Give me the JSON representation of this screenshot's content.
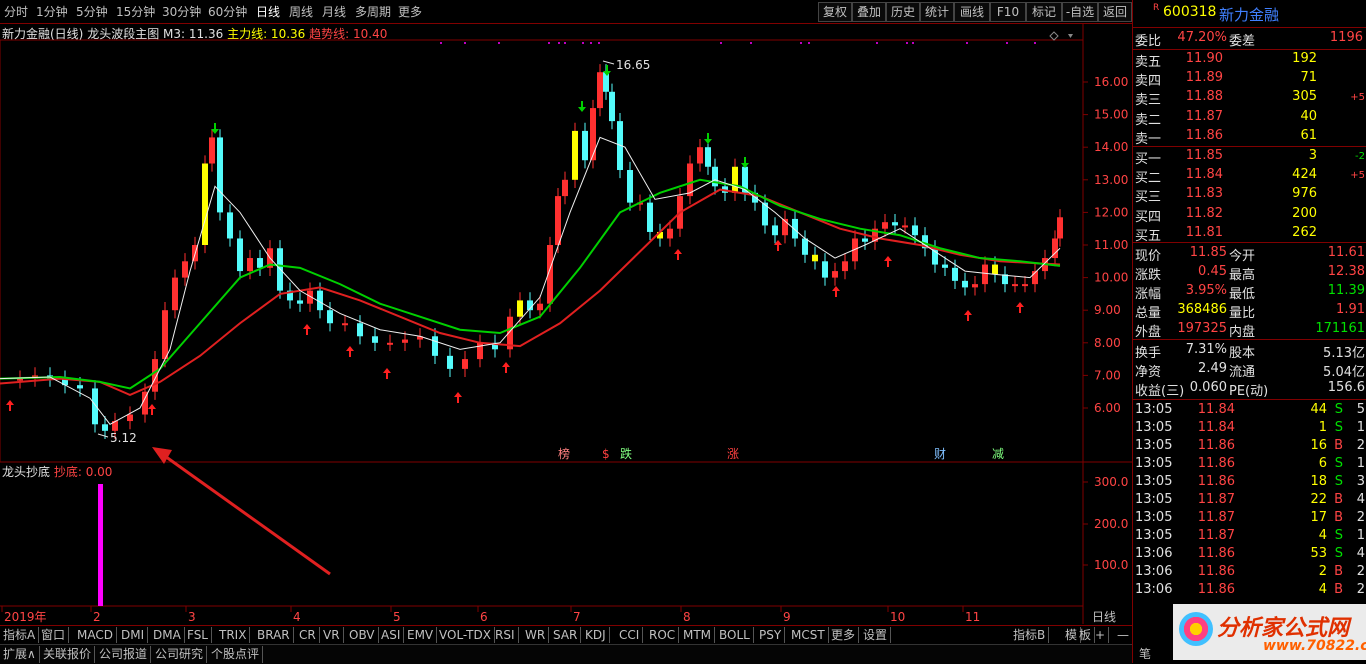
{
  "toolbar": {
    "periods": [
      "分时",
      "1分钟",
      "5分钟",
      "15分钟",
      "30分钟",
      "60分钟",
      "日线",
      "周线",
      "月线",
      "多周期",
      "更多"
    ],
    "selected": "日线",
    "right_buttons": [
      "复权",
      "叠加",
      "历史",
      "统计",
      "画线",
      "F10",
      "标记",
      "-自选",
      "返回"
    ]
  },
  "chart": {
    "stock_name": "新力金融(日线)",
    "formula_name": "龙头波段主图",
    "m3_label": "M3: 11.36",
    "main_line_label": "主力线: 10.36",
    "trend_line_label": "趋势线: 10.40",
    "high_annotation": "16.65",
    "low_annotation": "5.12",
    "price_ticks": [
      "16.00",
      "15.00",
      "14.00",
      "13.00",
      "12.00",
      "11.00",
      "10.00",
      "9.00",
      "8.00",
      "7.00",
      "6.00"
    ],
    "date_ticks": [
      "2019年",
      "2",
      "3",
      "4",
      "5",
      "6",
      "7",
      "8",
      "9",
      "10",
      "11"
    ],
    "period_label": "日线",
    "event_markers": [
      "榜",
      "$",
      "跌",
      "涨",
      "财",
      "减"
    ]
  },
  "indicator": {
    "name": "龙头抄底",
    "value_label": "抄底: 0.00",
    "ticks": [
      "300.0",
      "200.0",
      "100.0"
    ]
  },
  "chart_data": {
    "type": "candlestick",
    "title": "新力金融(日线)",
    "ylim": [
      5.0,
      17.0
    ],
    "high": 16.65,
    "low": 5.12,
    "x": [
      "2019年",
      "2",
      "3",
      "4",
      "5",
      "6",
      "7",
      "8",
      "9",
      "10",
      "11"
    ]
  },
  "tabs_bottom": [
    "指标A",
    "窗口",
    "MACD",
    "DMI",
    "DMA",
    "FSL",
    "TRIX",
    "BRAR",
    "CR",
    "VR",
    "OBV",
    "ASI",
    "EMV",
    "VOL-TDX",
    "RSI",
    "WR",
    "SAR",
    "KDJ",
    "CCI",
    "ROC",
    "MTM",
    "BOLL",
    "PSY",
    "MCST",
    "更多",
    "设置"
  ],
  "tabs_bottom_right": [
    "指标B",
    "模",
    "板",
    "+",
    "—"
  ],
  "tabs_bottom2": [
    "扩展∧",
    "关联报价",
    "公司报道",
    "公司研究",
    "个股点评"
  ],
  "quote": {
    "code": "600318",
    "name": "新力金融",
    "weibi_label": "委比",
    "weibi_value": "47.20%",
    "weicha_label": "委差",
    "weicha_value": "1196",
    "asks": [
      {
        "label": "卖五",
        "price": "11.90",
        "vol": "192",
        "chg": ""
      },
      {
        "label": "卖四",
        "price": "11.89",
        "vol": "71",
        "chg": ""
      },
      {
        "label": "卖三",
        "price": "11.88",
        "vol": "305",
        "chg": "+5"
      },
      {
        "label": "卖二",
        "price": "11.87",
        "vol": "40",
        "chg": ""
      },
      {
        "label": "卖一",
        "price": "11.86",
        "vol": "61",
        "chg": ""
      }
    ],
    "bids": [
      {
        "label": "买一",
        "price": "11.85",
        "vol": "3",
        "chg": "-2"
      },
      {
        "label": "买二",
        "price": "11.84",
        "vol": "424",
        "chg": "+5"
      },
      {
        "label": "买三",
        "price": "11.83",
        "vol": "976",
        "chg": ""
      },
      {
        "label": "买四",
        "price": "11.82",
        "vol": "200",
        "chg": ""
      },
      {
        "label": "买五",
        "price": "11.81",
        "vol": "262",
        "chg": ""
      }
    ],
    "stats": [
      {
        "l1": "现价",
        "v1": "11.85",
        "l2": "今开",
        "v2": "11.61"
      },
      {
        "l1": "涨跌",
        "v1": "0.45",
        "l2": "最高",
        "v2": "12.38"
      },
      {
        "l1": "涨幅",
        "v1": "3.95%",
        "l2": "最低",
        "v2": "11.39"
      },
      {
        "l1": "总量",
        "v1": "368486",
        "l2": "量比",
        "v2": "1.91"
      },
      {
        "l1": "外盘",
        "v1": "197325",
        "l2": "内盘",
        "v2": "171161"
      }
    ],
    "stats2": [
      {
        "l1": "换手",
        "v1": "7.31%",
        "l2": "股本",
        "v2": "5.13亿"
      },
      {
        "l1": "净资",
        "v1": "2.49",
        "l2": "流通",
        "v2": "5.04亿"
      },
      {
        "l1": "收益(三)",
        "v1": "0.060",
        "l2": "PE(动)",
        "v2": "156.6"
      }
    ],
    "ticks": [
      {
        "t": "13:05",
        "p": "11.84",
        "v": "44",
        "d": "S",
        "n": "5"
      },
      {
        "t": "13:05",
        "p": "11.84",
        "v": "1",
        "d": "S",
        "n": "1"
      },
      {
        "t": "13:05",
        "p": "11.86",
        "v": "16",
        "d": "B",
        "n": "2"
      },
      {
        "t": "13:05",
        "p": "11.86",
        "v": "6",
        "d": "S",
        "n": "1"
      },
      {
        "t": "13:05",
        "p": "11.86",
        "v": "18",
        "d": "S",
        "n": "3"
      },
      {
        "t": "13:05",
        "p": "11.87",
        "v": "22",
        "d": "B",
        "n": "4"
      },
      {
        "t": "13:05",
        "p": "11.87",
        "v": "17",
        "d": "B",
        "n": "2"
      },
      {
        "t": "13:05",
        "p": "11.87",
        "v": "4",
        "d": "S",
        "n": "1"
      },
      {
        "t": "13:06",
        "p": "11.86",
        "v": "53",
        "d": "S",
        "n": "4"
      },
      {
        "t": "13:06",
        "p": "11.86",
        "v": "2",
        "d": "B",
        "n": "2"
      },
      {
        "t": "13:06",
        "p": "11.86",
        "v": "4",
        "d": "B",
        "n": "2"
      }
    ],
    "watermark": "分析家公式网",
    "watermark_url": "www.70822.com"
  }
}
